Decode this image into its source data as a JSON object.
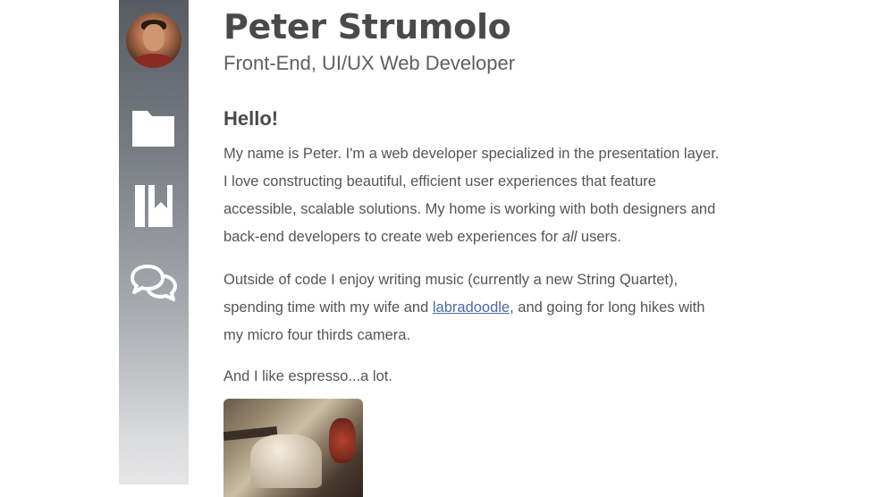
{
  "profile": {
    "name": "Peter Strumolo",
    "role": "Front-End, UI/UX Web Developer"
  },
  "sidebar": {
    "items": [
      {
        "icon": "folder-icon"
      },
      {
        "icon": "bookmark-icon"
      },
      {
        "icon": "chat-icon"
      }
    ]
  },
  "about": {
    "heading": "Hello!",
    "p1_before_em": "My name is Peter. I'm a web developer specialized in the presentation layer. I love constructing beautiful, efficient user experiences that feature accessible, scalable solutions. My home is working with both designers and back-end developers to create web experiences for ",
    "p1_em": "all",
    "p1_after_em": " users.",
    "p2_before_link": "Outside of code I enjoy writing music (currently a new String Quartet), spending time with my wife and ",
    "p2_link": "labradoodle",
    "p2_after_link": ", and going for long hikes with my micro four thirds camera.",
    "p3": "And I like espresso...a lot."
  },
  "colors": {
    "sidebar_top": "#575c63",
    "sidebar_bottom": "#e6e6e7",
    "link": "#4d6aa8",
    "text": "#555555"
  }
}
